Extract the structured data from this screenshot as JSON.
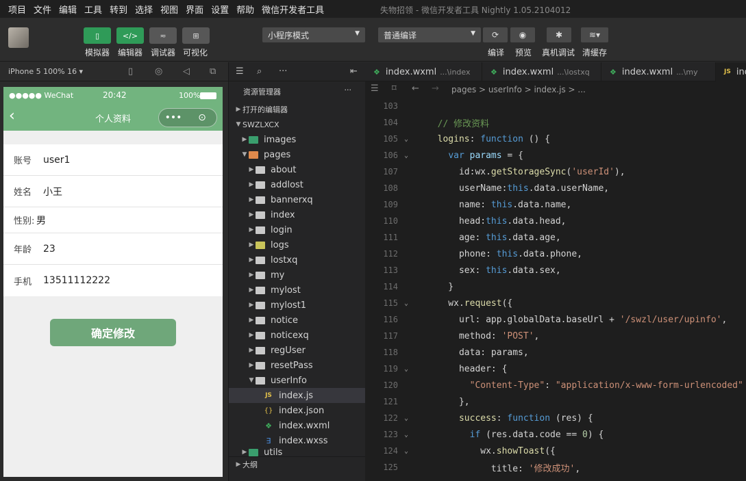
{
  "menubar": {
    "items": [
      "项目",
      "文件",
      "编辑",
      "工具",
      "转到",
      "选择",
      "视图",
      "界面",
      "设置",
      "帮助",
      "微信开发者工具"
    ],
    "title": "失物招领 - 微信开发者工具 Nightly 1.05.2104012"
  },
  "toolbar": {
    "simulator": "模拟器",
    "editor": "编辑器",
    "debugger": "调试器",
    "visual": "可视化",
    "mode": "小程序模式",
    "compile_mode": "普通编译",
    "compile": "编译",
    "preview": "预览",
    "remote_debug": "真机调试",
    "clear_cache": "清缓存"
  },
  "simulator": {
    "device": "iPhone 5 100% 16 ▾",
    "status_left": "●●●●● WeChat",
    "time": "20:42",
    "battery": "100%",
    "nav_title": "个人资料",
    "fields": [
      {
        "label": "账号",
        "value": "user1"
      },
      {
        "label": "姓名",
        "value": "小王"
      },
      {
        "label": "性别:",
        "value": "男"
      },
      {
        "label": "年龄",
        "value": "23"
      },
      {
        "label": "手机",
        "value": "13511112222"
      }
    ],
    "confirm": "确定修改"
  },
  "explorer": {
    "title": "资源管理器",
    "open_editors": "打开的编辑器",
    "project": "SWZLXCX",
    "folders": [
      "images",
      "pages",
      "about",
      "addlost",
      "bannerxq",
      "index",
      "login",
      "logs",
      "lostxq",
      "my",
      "mylost",
      "mylost1",
      "notice",
      "noticexq",
      "regUser",
      "resetPass",
      "userInfo"
    ],
    "files": [
      "index.js",
      "index.json",
      "index.wxml",
      "index.wxss"
    ],
    "utils": "utils",
    "outline": "大纲"
  },
  "editor": {
    "tabs": [
      {
        "name": "index.wxml",
        "path": "...\\index"
      },
      {
        "name": "index.wxml",
        "path": "...\\lostxq"
      },
      {
        "name": "index.wxml",
        "path": "...\\my"
      },
      {
        "name": "ind",
        "path": ""
      }
    ],
    "breadcrumb": "pages > userInfo > index.js > ...",
    "line_numbers": [
      "103",
      "104",
      "105",
      "106",
      "107",
      "108",
      "109",
      "110",
      "111",
      "112",
      "113",
      "114",
      "115",
      "116",
      "117",
      "118",
      "119",
      "120",
      "121",
      "122",
      "123",
      "124",
      "125"
    ]
  }
}
